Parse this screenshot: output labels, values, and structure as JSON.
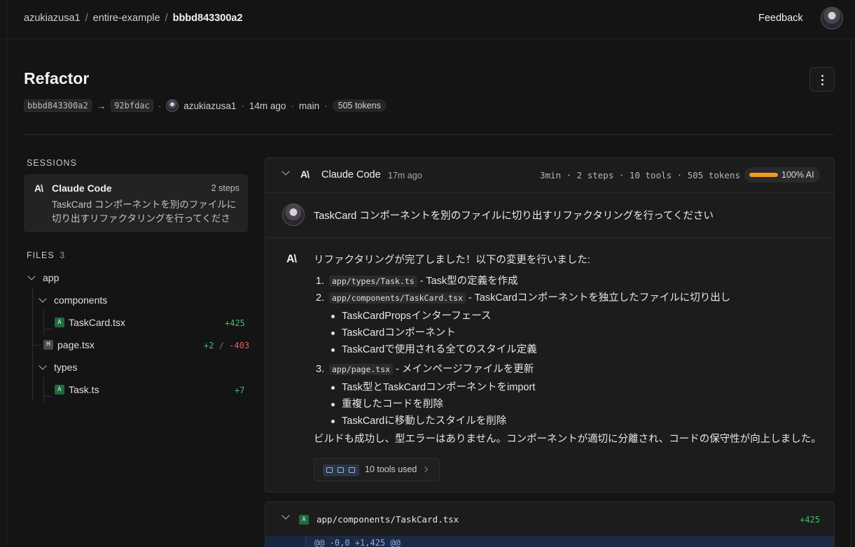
{
  "breadcrumb": {
    "owner": "azukiazusa1",
    "repo": "entire-example",
    "commit": "bbbd843300a2"
  },
  "header_actions": {
    "feedback": "Feedback"
  },
  "checkpoint": {
    "title": "Refactor",
    "from_commit": "bbbd843300a2",
    "to_commit": "92bfdac",
    "author": "azukiazusa1",
    "time": "14m ago",
    "branch": "main",
    "tokens": "505 tokens"
  },
  "sidebar": {
    "sessions_label": "SESSIONS",
    "session": {
      "name": "Claude Code",
      "steps": "2 steps",
      "description": "TaskCard コンポーネントを別のファイルに切り出すリファクタリングを行ってください"
    },
    "files_label": "FILES",
    "files_count": "3",
    "tree": {
      "app": "app",
      "components": "components",
      "taskcard": {
        "badge": "A",
        "name": "TaskCard.tsx",
        "added": "+425"
      },
      "page": {
        "badge": "M",
        "name": "page.tsx",
        "added": "+2",
        "sep": "/",
        "removed": "-403"
      },
      "types": "types",
      "task": {
        "badge": "A",
        "name": "Task.ts",
        "added": "+7"
      }
    }
  },
  "session_card": {
    "agent": "Claude Code",
    "time": "17m ago",
    "stats": "3min · 2 steps · 10 tools · 505 tokens",
    "ai_share": 1.0,
    "ai_label": "100% AI",
    "user_message": "TaskCard コンポーネントを別のファイルに切り出すリファクタリングを行ってください",
    "response": {
      "intro": "リファクタリングが完了しました！以下の変更を行いました:",
      "step1": {
        "num": "1.",
        "code": "app/types/Task.ts",
        "text": " - Task型の定義を作成"
      },
      "step2": {
        "num": "2.",
        "code": "app/components/TaskCard.tsx",
        "text": " - TaskCardコンポーネントを独立したファイルに切り出し",
        "bullets": [
          "TaskCardPropsインターフェース",
          "TaskCardコンポーネント",
          "TaskCardで使用される全てのスタイル定義"
        ]
      },
      "step3": {
        "num": "3.",
        "code": "app/page.tsx",
        "text": " - メインページファイルを更新",
        "bullets": [
          "Task型とTaskCardコンポーネントをimport",
          "重複したコードを削除",
          "TaskCardに移動したスタイルを削除"
        ]
      },
      "outro": "ビルドも成功し、型エラーはありません。コンポーネントが適切に分離され、コードの保守性が向上しました。"
    },
    "tools_used": "10 tools used"
  },
  "diff": {
    "badge": "A",
    "path": "app/components/TaskCard.tsx",
    "added": "+425",
    "hunk": "@@ -0,0 +1,425 @@"
  },
  "colors": {
    "accent_orange": "#f29a1f",
    "added": "#3fbf6a",
    "removed": "#e0615f"
  }
}
